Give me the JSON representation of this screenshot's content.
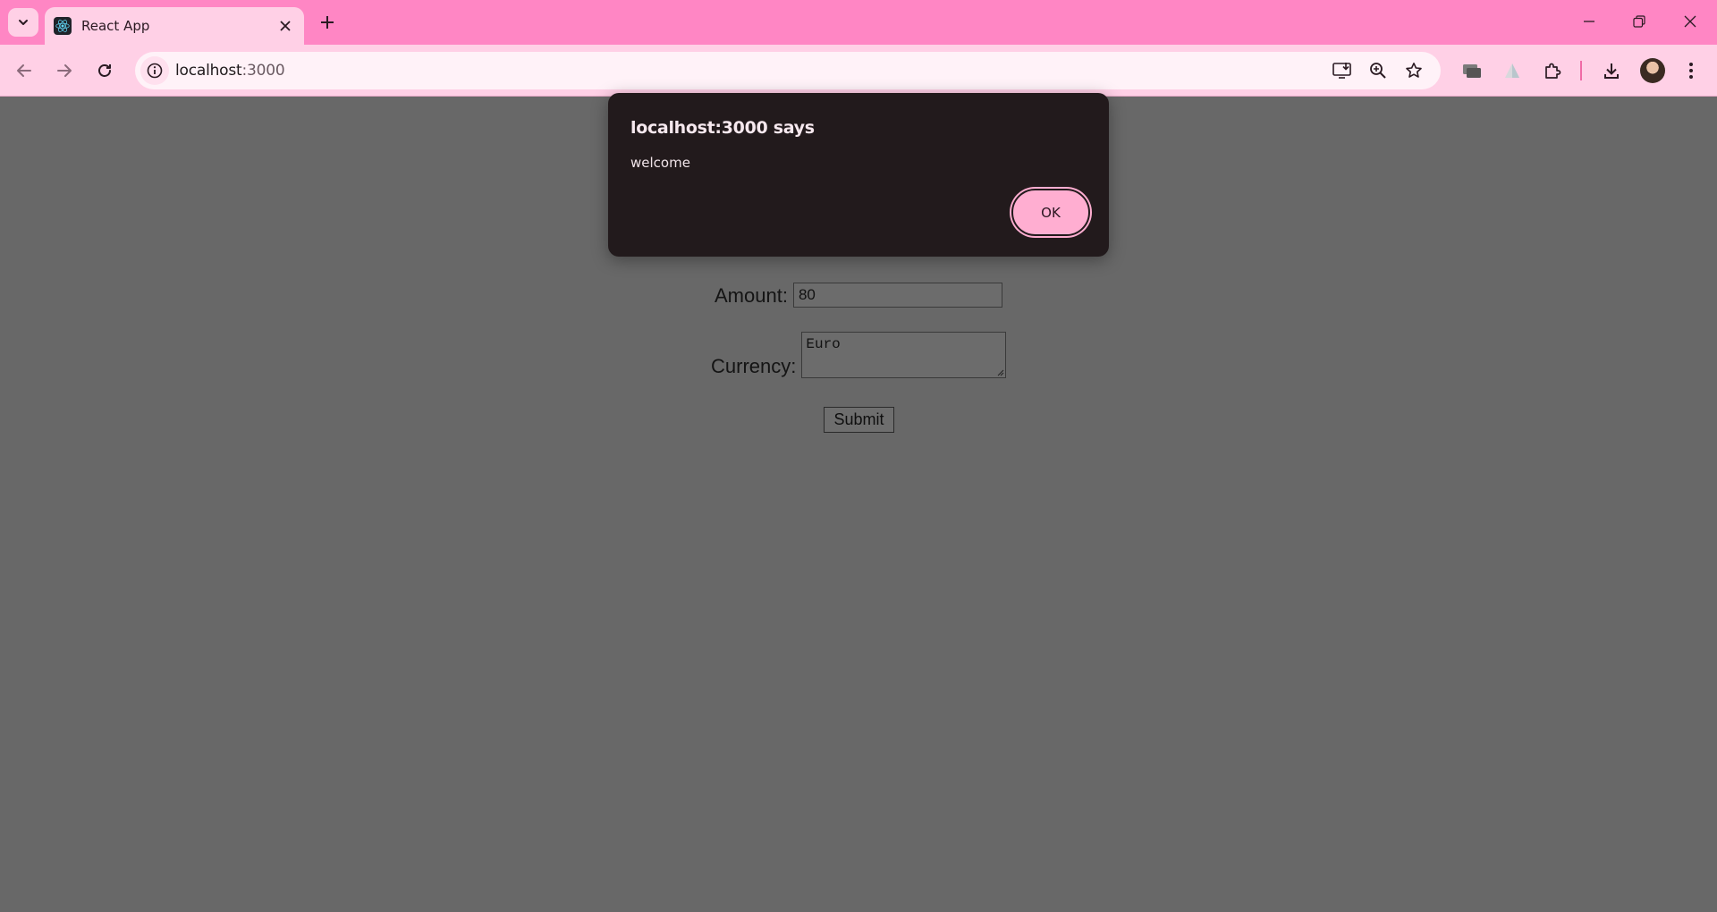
{
  "browser": {
    "tab_title": "React App",
    "url_host": "localhost",
    "url_port": ":3000",
    "theme_color": "#ff86c4"
  },
  "form": {
    "amount_label": "Amount:",
    "amount_value": "80",
    "currency_label": "Currency:",
    "currency_value": "Euro",
    "submit_label": "Submit"
  },
  "dialog": {
    "title": "localhost:3000 says",
    "message": "welcome",
    "ok_label": "OK"
  }
}
